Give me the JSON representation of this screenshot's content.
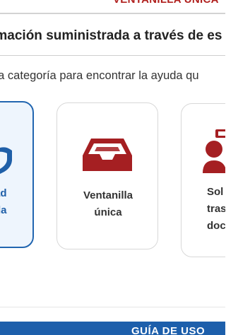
{
  "header": {
    "banner_text": "VENTANILLA ÚNICA"
  },
  "section": {
    "title": "rmación suministrada a través de es",
    "subtitle": "na categoría para encontrar la ayuda qu"
  },
  "cards": [
    {
      "label": "ad\nda",
      "icon": "shield-icon",
      "selected": true
    },
    {
      "label": "Ventanilla\núnica",
      "icon": "inbox-tray-icon",
      "selected": false
    },
    {
      "label": "Sol\ntrasl\ndoc",
      "icon": "user-document-icon",
      "selected": false
    }
  ],
  "footer": {
    "button_label": "GUÍA DE USO"
  },
  "colors": {
    "accent_red": "#a51f22",
    "accent_blue": "#1d5fab",
    "selected_bg": "#eef5fd"
  }
}
